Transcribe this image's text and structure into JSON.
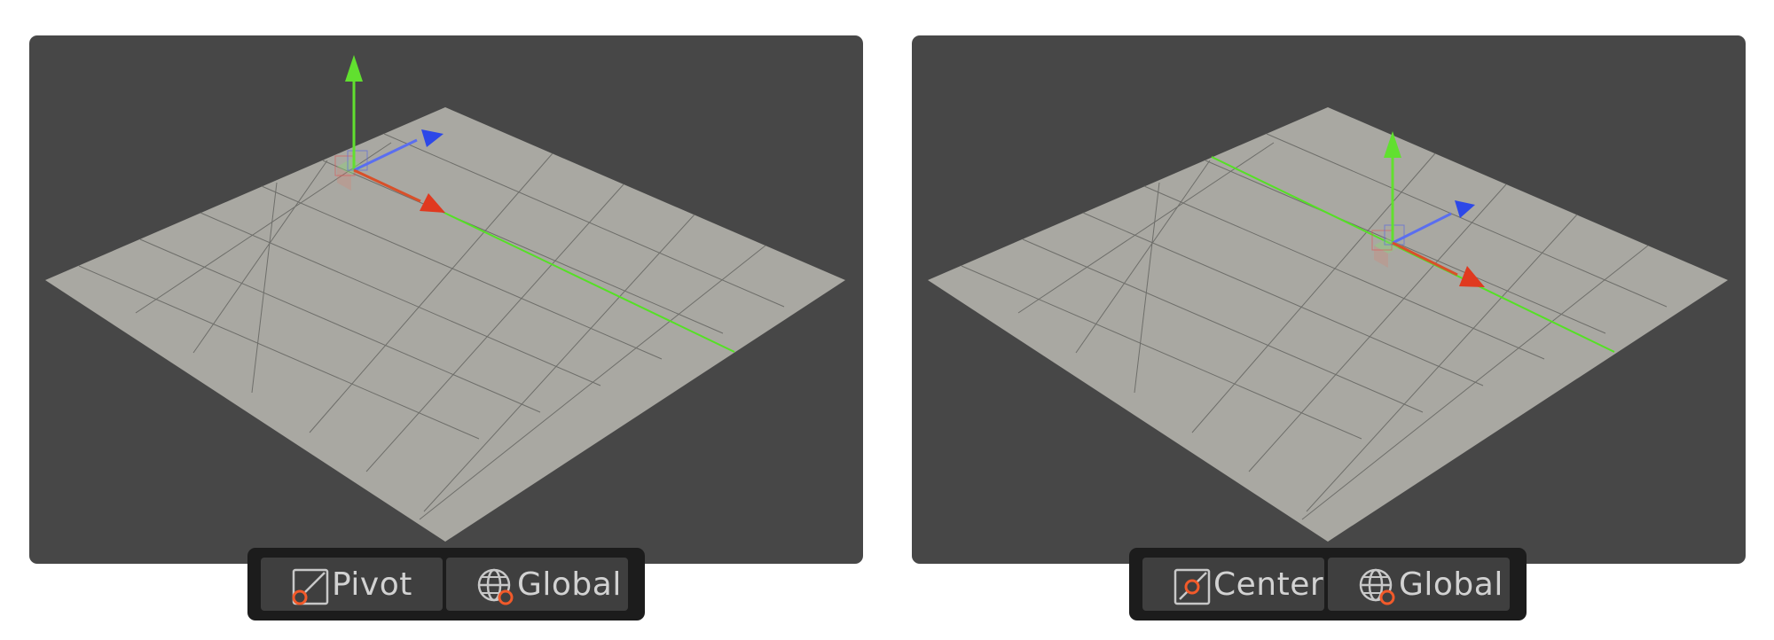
{
  "colors": {
    "viewport_bg": "#474747",
    "plane": "#a9a8a2",
    "grid_line": "#6e6e6a",
    "axis_x": "#e0391f",
    "axis_y": "#61e02f",
    "axis_z": "#2d48e8",
    "toolbar_bg": "#1c1c1c",
    "button_bg": "#3f3f3f",
    "label_text": "#d2d2d2",
    "icon_accent": "#f25a2a"
  },
  "panels": [
    {
      "pivot_mode": {
        "label": "Pivot",
        "icon": "pivot-icon"
      },
      "space_mode": {
        "label": "Global",
        "icon": "globe-icon"
      },
      "gizmo_location": "corner"
    },
    {
      "pivot_mode": {
        "label": "Center",
        "icon": "center-icon"
      },
      "space_mode": {
        "label": "Global",
        "icon": "globe-icon"
      },
      "gizmo_location": "center"
    }
  ]
}
